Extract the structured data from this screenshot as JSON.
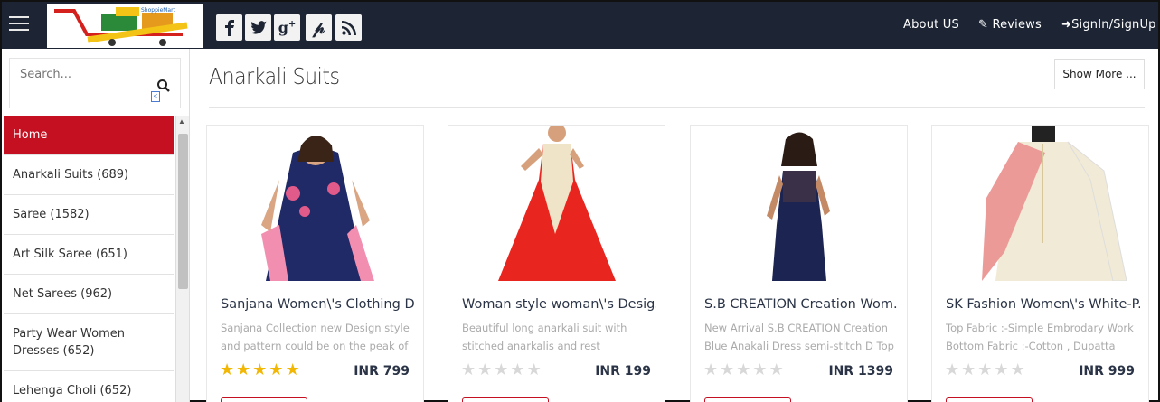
{
  "header": {
    "logo_alt": "ShoppieMart",
    "social": [
      "facebook-icon",
      "twitter-icon",
      "google-plus-icon",
      "pinterest-icon",
      "rss-icon"
    ],
    "nav": [
      {
        "label": "About US",
        "icon": ""
      },
      {
        "label": "Reviews",
        "icon": "pencil-icon"
      },
      {
        "label": "SignIn/SignUp",
        "icon": "sign-in-icon"
      }
    ]
  },
  "sidebar": {
    "search_placeholder": "Search...",
    "categories": [
      {
        "label": "Home",
        "active": true
      },
      {
        "label": "Anarkali Suits (689)"
      },
      {
        "label": "Saree (1582)"
      },
      {
        "label": "Art Silk Saree (651)"
      },
      {
        "label": "Net Sarees (962)"
      },
      {
        "label": "Party Wear Women Dresses (652)"
      },
      {
        "label": "Lehenga Choli (652)"
      }
    ]
  },
  "main": {
    "title": "Anarkali Suits",
    "show_more": "Show More ...",
    "products": [
      {
        "title": "Sanjana Women\\'s Clothing D...",
        "desc": "Sanjana Collection new Design style and pattern could be on the peak of your",
        "rating": 5,
        "price": "INR 799"
      },
      {
        "title": "Woman style woman\\'s Desig...",
        "desc": "Beautiful long anarkali suit with stitched anarkalis and rest unstitched . It is",
        "rating": 0,
        "price": "INR 199"
      },
      {
        "title": "S.B CREATION Creation Wom...",
        "desc": "New Arrival S.B CREATION Creation Blue Anakali Dress semi-stitch D Top :",
        "rating": 0,
        "price": "INR 1399"
      },
      {
        "title": "SK Fashion Women\\'s White-P...",
        "desc": "Top Fabric :-Simple Embrodary Work Bottom Fabric :-Cotton , Dupatta",
        "rating": 0,
        "price": "INR 999"
      }
    ]
  },
  "colors": {
    "header_bg": "#1d2535",
    "accent": "#c51021",
    "star_on": "#f2b705",
    "star_off": "#d8d8d8"
  }
}
